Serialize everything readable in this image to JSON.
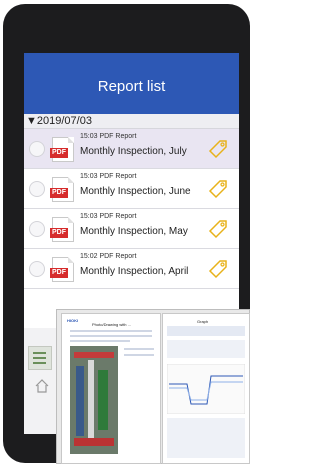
{
  "header": {
    "title": "Report list"
  },
  "list": {
    "date": "▼2019/07/03",
    "items": [
      {
        "time": "15:03",
        "type": "PDF Report",
        "title": "Monthly Inspection, July",
        "selected": true
      },
      {
        "time": "15:03",
        "type": "PDF Report",
        "title": "Monthly Inspection, June",
        "selected": false
      },
      {
        "time": "15:03",
        "type": "PDF Report",
        "title": "Monthly Inspection, May",
        "selected": false
      },
      {
        "time": "15:02",
        "type": "PDF Report",
        "title": "Monthly Inspection, April",
        "selected": false
      }
    ],
    "pdf_badge": "PDF"
  },
  "overlay": {
    "doc1_brand": "HIOKI",
    "doc1_title": "Photo/Drawing with ...",
    "doc2_title": "Graph"
  },
  "colors": {
    "header": "#2d58b5",
    "tag": "#e8b21a",
    "pdf": "#d62b2b"
  },
  "icons": [
    "pdf-icon",
    "tag-icon",
    "menu-icon",
    "home-icon"
  ]
}
